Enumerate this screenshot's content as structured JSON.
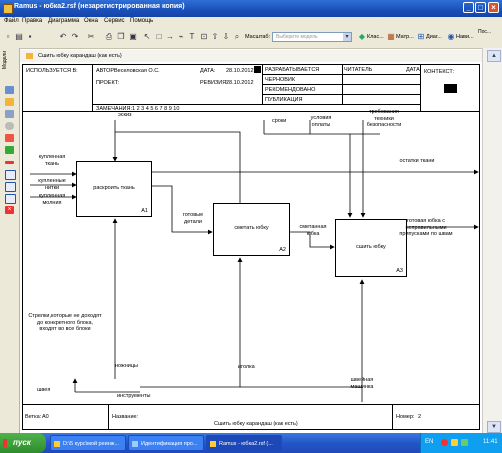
{
  "window": {
    "title": "Ramus - юбка2.rsf (незарегистрированная копия)",
    "minimize": "_",
    "maximize": "□",
    "close": "×"
  },
  "menu": [
    "Файл",
    "Правка",
    "Диаграмма",
    "Окна",
    "Сервис",
    "Помощь"
  ],
  "toolbar": {
    "zoom_label": "Масштаб:",
    "model_placeholder": "Выберите модель",
    "buttons": [
      "Клас...",
      "Матр...",
      "Диаг...",
      "Нави...",
      "Пос..."
    ]
  },
  "side_panel": {
    "label": "Модели"
  },
  "document": {
    "tab_title": "Сшить юбку карандаш (как есть)"
  },
  "header": {
    "used_in": "ИСПОЛЬЗУЕТСЯ В:",
    "author_label": "АВТОР:",
    "author": "Веселовская О.С.",
    "project_label": "ПРОЕКТ:",
    "date_label": "ДАТА:",
    "date": "28.10.2012",
    "revision_label": "РЕВИЗИЯ:",
    "revision": "28.10.2012",
    "notes_label": "ЗАМЕЧАНИЯ:",
    "notes": "1 2 3 4 5 6 7 8 9 10",
    "status": [
      "РАЗРАБАТЫВАЕТСЯ",
      "ЧЕРНОВИК",
      "РЕКОМЕНДОВАНО",
      "ПУБЛИКАЦИЯ"
    ],
    "reader": "ЧИТАТЕЛЬ",
    "date2": "ДАТА",
    "context": "КОНТЕКСТ:"
  },
  "diagram": {
    "boxes": [
      {
        "name": "раскроить ткань",
        "num": "A1"
      },
      {
        "name": "сметать юбку",
        "num": "A2"
      },
      {
        "name": "сшить юбку",
        "num": "A3"
      }
    ],
    "arrows": {
      "sketch": "эскиз",
      "terms": "сроки",
      "payment": "условия оплаты",
      "safety": "требования техники безопасности",
      "fabric": "купленная ткань",
      "threads": "купленные нитки",
      "zipper": "купленная молния",
      "remains": "остатки ткани",
      "parts": "готовые детали",
      "basted": "сметанная юбка",
      "finished": "готовая юбка с неправильными припусками по швам",
      "note": "Стрелки,которые не доходят до конкретного блока, входят во все блоки",
      "scissors": "ножницы",
      "needle": "иголка",
      "seamstress": "швея",
      "tools": "инструменты",
      "machine": "швейная машинка"
    }
  },
  "footer": {
    "node_label": "Ветка:",
    "node": "A0",
    "name_label": "Название:",
    "name": "Сшить юбку карандаш (как есть)",
    "number_label": "Номер:",
    "number": "2"
  },
  "taskbar": {
    "start": "пуск",
    "tasks": [
      "D:\\5 курс\\мой реинж...",
      "Идентификация про...",
      "Ramus - юбка2.rsf (..."
    ],
    "lang": "EN",
    "clock": "11:41"
  }
}
